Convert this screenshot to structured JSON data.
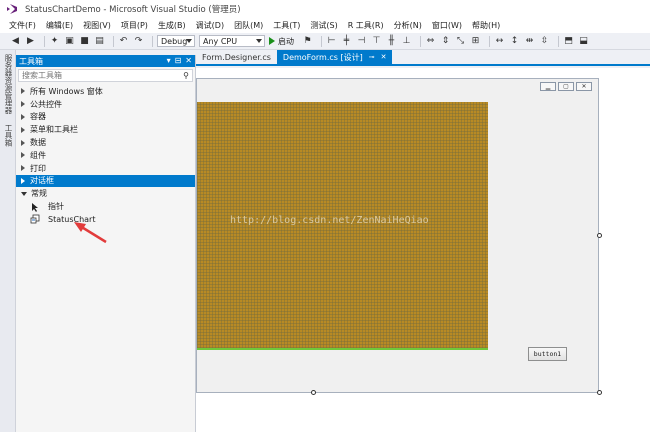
{
  "window": {
    "title": "StatusChartDemo - Microsoft Visual Studio (管理员)"
  },
  "menu": [
    "文件(F)",
    "编辑(E)",
    "视图(V)",
    "项目(P)",
    "生成(B)",
    "调试(D)",
    "团队(M)",
    "工具(T)",
    "测试(S)",
    "R 工具(R)",
    "分析(N)",
    "窗口(W)",
    "帮助(H)"
  ],
  "toolbar": {
    "config": "Debug",
    "platform": "Any CPU",
    "start_label": "启动"
  },
  "side_tabs": [
    "服务器资源管理器",
    "工具箱"
  ],
  "toolbox": {
    "title": "工具箱",
    "search_placeholder": "搜索工具箱",
    "categories": [
      "所有 Windows 窗体",
      "公共控件",
      "容器",
      "菜单和工具栏",
      "数据",
      "组件",
      "打印",
      "对话框"
    ],
    "selected_category": "对话框",
    "general": {
      "label": "常规",
      "items": [
        "指针",
        "StatusChart"
      ]
    }
  },
  "doc_tabs": [
    {
      "label": "Form.Designer.cs",
      "active": false
    },
    {
      "label": "DemoForm.cs [设计]",
      "active": true
    }
  ],
  "form": {
    "button_text": "button1"
  },
  "watermark": "http://blog.csdn.net/ZenNaiHeQiao",
  "colors": {
    "accent": "#007acc",
    "chart_fill": "#b88a24",
    "chart_grid": "#7a6e3c",
    "annotation_arrow": "#e23b3b"
  }
}
